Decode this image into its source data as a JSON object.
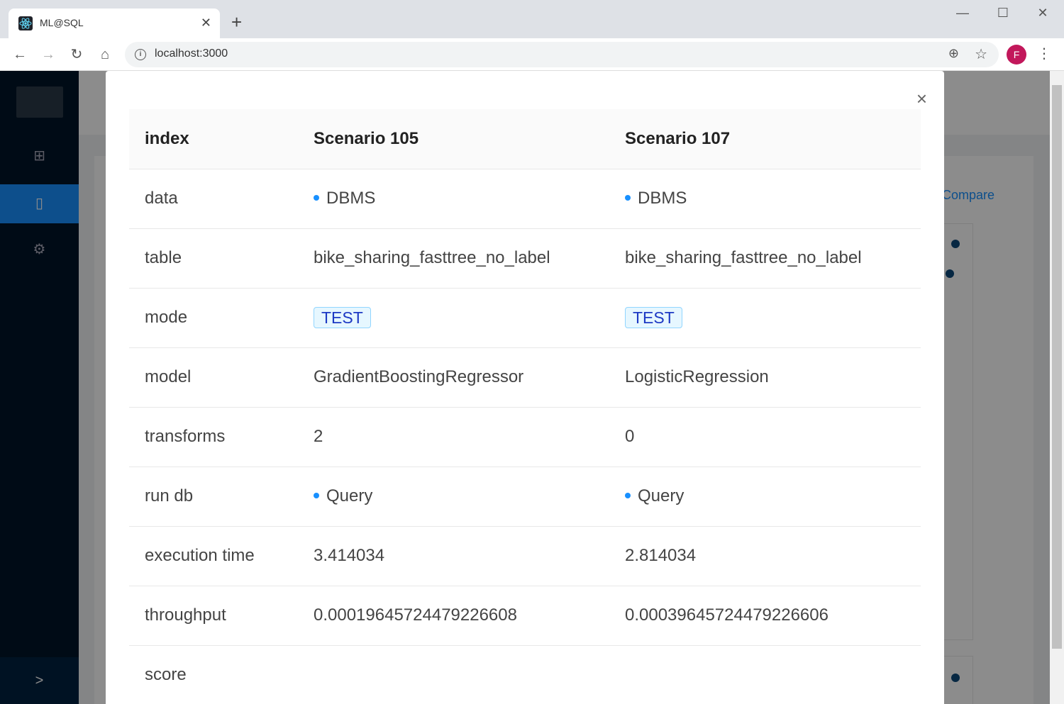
{
  "browser": {
    "tab_title": "ML@SQL",
    "url": "localhost:3000",
    "profile_initial": "F",
    "new_tab_label": "+",
    "window_controls": [
      "minimize-icon",
      "maximize-icon",
      "close-icon"
    ]
  },
  "background": {
    "compare_link": "Compare"
  },
  "modal": {
    "close_label": "×",
    "headers": [
      "index",
      "Scenario 105",
      "Scenario 107"
    ],
    "rows": [
      {
        "label": "data",
        "a": "DBMS",
        "b": "DBMS"
      },
      {
        "label": "table",
        "a": "bike_sharing_fasttree_no_label",
        "b": "bike_sharing_fasttree_no_label"
      },
      {
        "label": "mode",
        "a": "TEST",
        "b": "TEST"
      },
      {
        "label": "model",
        "a": "GradientBoostingRegressor",
        "b": "LogisticRegression"
      },
      {
        "label": "transforms",
        "a": "2",
        "b": "0"
      },
      {
        "label": "run db",
        "a": "Query",
        "b": "Query"
      },
      {
        "label": "execution time",
        "a": "3.414034",
        "b": "2.814034"
      },
      {
        "label": "throughput",
        "a": "0.00019645724479226608",
        "b": "0.00039645724479226606"
      },
      {
        "label": "score",
        "a": "",
        "b": ""
      }
    ]
  },
  "colors": {
    "sider": "#001529",
    "accent": "#1890ff",
    "tag_text": "#1d39c4",
    "avatar": "#c2185b"
  }
}
